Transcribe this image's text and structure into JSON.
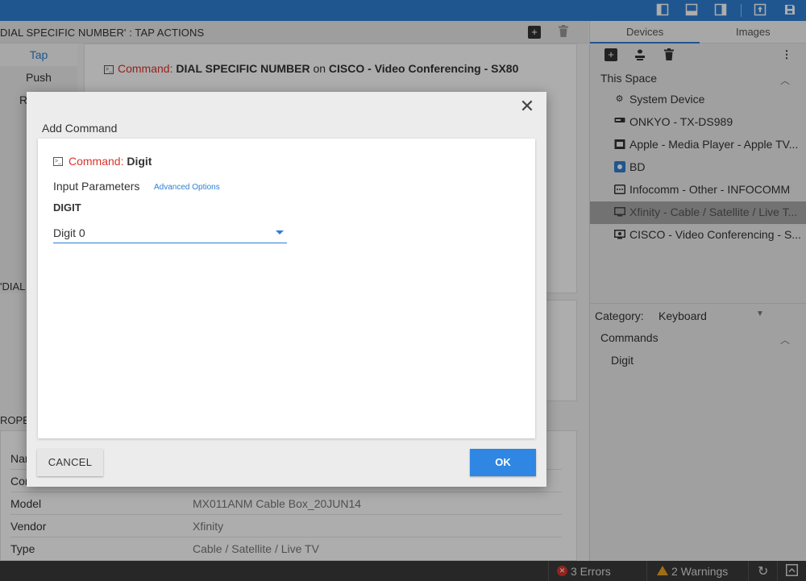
{
  "topbar": {
    "icons": [
      "left-panel-icon",
      "bottom-panel-icon",
      "right-panel-icon",
      "export-icon",
      "save-icon"
    ]
  },
  "actions": {
    "title": "DIAL SPECIFIC NUMBER' : TAP ACTIONS",
    "tabs": [
      "Tap",
      "Push",
      "R"
    ],
    "command_prefix": "Command:",
    "command_name": "DIAL SPECIFIC NUMBER",
    "command_on": "on",
    "command_device": "CISCO - Video Conferencing - SX80"
  },
  "dial_strip": "'DIAL",
  "props_strip": "ROPE",
  "properties": [
    {
      "key": "Nar",
      "value": ""
    },
    {
      "key": "Cor",
      "value": ""
    },
    {
      "key": "Model",
      "value": "MX011ANM Cable Box_20JUN14"
    },
    {
      "key": "Vendor",
      "value": "Xfinity"
    },
    {
      "key": "Type",
      "value": "Cable / Satellite / Live TV"
    }
  ],
  "sidebar": {
    "tabs": [
      "Devices",
      "Images"
    ],
    "active_tab": "Devices",
    "space_header": "This Space",
    "devices": [
      {
        "label": "System Device",
        "icon": "gear-icon",
        "selected": false
      },
      {
        "label": "ONKYO - TX-DS989",
        "icon": "receiver-icon",
        "selected": false
      },
      {
        "label": "Apple - Media Player - Apple TV...",
        "icon": "media-player-icon",
        "selected": false
      },
      {
        "label": "BD",
        "icon": "bluray-icon",
        "selected": false
      },
      {
        "label": "Infocomm - Other - INFOCOMM",
        "icon": "other-device-icon",
        "selected": false
      },
      {
        "label": "Xfinity - Cable / Satellite / Live T...",
        "icon": "cable-box-icon",
        "selected": true
      },
      {
        "label": "CISCO - Video Conferencing - S...",
        "icon": "video-conf-icon",
        "selected": false
      }
    ],
    "category_label": "Category:",
    "category_value": "Keyboard",
    "commands_header": "Commands",
    "commands": [
      "Digit"
    ]
  },
  "statusbar": {
    "errors": "3 Errors",
    "warnings": "2 Warnings"
  },
  "modal": {
    "title": "Add Command",
    "command_prefix": "Command:",
    "command_name": "Digit",
    "input_params_label": "Input Parameters",
    "advanced_options": "Advanced Options",
    "param_label": "DIGIT",
    "param_value": "Digit 0",
    "cancel_label": "CANCEL",
    "ok_label": "OK"
  },
  "colors": {
    "accent": "#2f7fd3",
    "command_red": "#d9342b",
    "selected_row": "#a9a9a9"
  }
}
